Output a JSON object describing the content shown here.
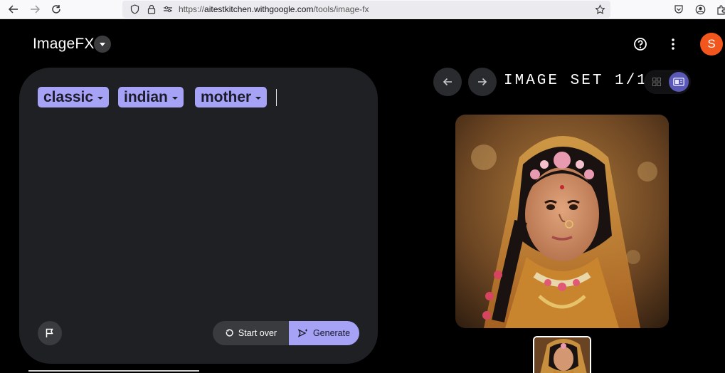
{
  "browser": {
    "url_prefix": "https://",
    "url_domain": "aitestkitchen.withgoogle.com",
    "url_path": "/tools/image-fx"
  },
  "app": {
    "title": "ImageFX",
    "avatar_letter": "S",
    "accent_color": "#a6a2f5",
    "avatar_color": "#f2561d"
  },
  "prompt": {
    "chips": [
      {
        "label": "classic"
      },
      {
        "label": "indian"
      },
      {
        "label": "mother"
      }
    ],
    "start_over_label": "Start over",
    "generate_label": "Generate"
  },
  "image_set": {
    "label": "IMAGE SET 1/1"
  },
  "icons": [
    "back-icon",
    "forward-icon",
    "reload-icon",
    "shield-icon",
    "lock-icon",
    "permissions-icon",
    "star-icon",
    "pocket-icon",
    "account-icon",
    "extensions-icon",
    "chevron-down-icon",
    "help-icon",
    "more-vert-icon",
    "flag-icon",
    "reset-icon",
    "generate-icon",
    "arrow-left-icon",
    "arrow-right-icon",
    "grid-view-icon",
    "single-view-icon"
  ]
}
